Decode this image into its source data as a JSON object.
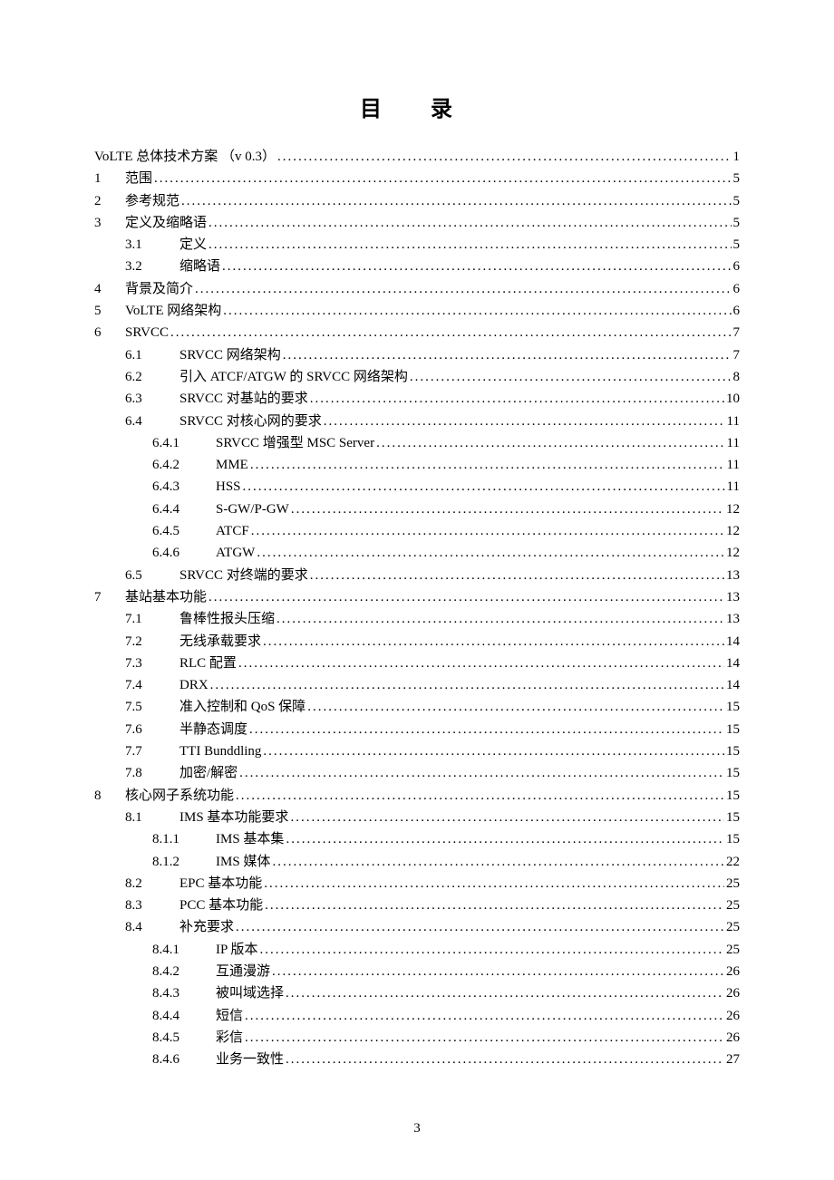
{
  "title": "目 录",
  "page_number": "3",
  "toc": [
    {
      "level": 0,
      "num": "",
      "text": "VoLTE 总体技术方案  （v 0.3）",
      "page": "1"
    },
    {
      "level": 0,
      "num": "1",
      "text": "范围",
      "page": "5"
    },
    {
      "level": 0,
      "num": "2",
      "text": "参考规范",
      "page": "5"
    },
    {
      "level": 0,
      "num": "3",
      "text": "定义及缩略语",
      "page": "5"
    },
    {
      "level": 1,
      "num": "3.1",
      "text": "定义",
      "page": "5"
    },
    {
      "level": 1,
      "num": "3.2",
      "text": "缩略语",
      "page": "6"
    },
    {
      "level": 0,
      "num": "4",
      "text": "背景及简介",
      "page": "6"
    },
    {
      "level": 0,
      "num": "5",
      "text": "VoLTE 网络架构",
      "page": "6"
    },
    {
      "level": 0,
      "num": "6",
      "text": "SRVCC",
      "page": "7"
    },
    {
      "level": 1,
      "num": "6.1",
      "text": "SRVCC 网络架构",
      "page": "7"
    },
    {
      "level": 1,
      "num": "6.2",
      "text": "引入 ATCF/ATGW 的 SRVCC 网络架构",
      "page": "8"
    },
    {
      "level": 1,
      "num": "6.3",
      "text": "SRVCC 对基站的要求",
      "page": "10"
    },
    {
      "level": 1,
      "num": "6.4",
      "text": "SRVCC 对核心网的要求",
      "page": "11"
    },
    {
      "level": 2,
      "num": "6.4.1",
      "text": "SRVCC 增强型 MSC Server",
      "page": "11"
    },
    {
      "level": 2,
      "num": "6.4.2",
      "text": "MME",
      "page": "11"
    },
    {
      "level": 2,
      "num": "6.4.3",
      "text": "HSS",
      "page": "11"
    },
    {
      "level": 2,
      "num": "6.4.4",
      "text": "S-GW/P-GW",
      "page": "12"
    },
    {
      "level": 2,
      "num": "6.4.5",
      "text": "ATCF",
      "page": "12"
    },
    {
      "level": 2,
      "num": "6.4.6",
      "text": "ATGW",
      "page": "12"
    },
    {
      "level": 1,
      "num": "6.5",
      "text": "SRVCC 对终端的要求",
      "page": "13"
    },
    {
      "level": 0,
      "num": "7",
      "text": "基站基本功能",
      "page": "13"
    },
    {
      "level": 1,
      "num": "7.1",
      "text": "鲁棒性报头压缩",
      "page": "13"
    },
    {
      "level": 1,
      "num": "7.2",
      "text": "无线承载要求",
      "page": "14"
    },
    {
      "level": 1,
      "num": "7.3",
      "text": "RLC 配置",
      "page": "14"
    },
    {
      "level": 1,
      "num": "7.4",
      "text": "DRX",
      "page": "14"
    },
    {
      "level": 1,
      "num": "7.5",
      "text": "准入控制和 QoS 保障",
      "page": "15"
    },
    {
      "level": 1,
      "num": "7.6",
      "text": "半静态调度",
      "page": "15"
    },
    {
      "level": 1,
      "num": "7.7",
      "text": "TTI Bunddling",
      "page": "15"
    },
    {
      "level": 1,
      "num": "7.8",
      "text": "加密/解密",
      "page": "15"
    },
    {
      "level": 0,
      "num": "8",
      "text": "核心网子系统功能",
      "page": "15"
    },
    {
      "level": 1,
      "num": "8.1",
      "text": "IMS 基本功能要求",
      "page": "15"
    },
    {
      "level": 2,
      "num": "8.1.1",
      "text": "IMS 基本集",
      "page": "15"
    },
    {
      "level": 2,
      "num": "8.1.2",
      "text": "IMS 媒体",
      "page": "22"
    },
    {
      "level": 1,
      "num": "8.2",
      "text": "EPC 基本功能",
      "page": "25"
    },
    {
      "level": 1,
      "num": "8.3",
      "text": "PCC 基本功能",
      "page": "25"
    },
    {
      "level": 1,
      "num": "8.4",
      "text": "补充要求",
      "page": "25"
    },
    {
      "level": 2,
      "num": "8.4.1",
      "text": "IP 版本",
      "page": "25"
    },
    {
      "level": 2,
      "num": "8.4.2",
      "text": "互通漫游",
      "page": "26"
    },
    {
      "level": 2,
      "num": "8.4.3",
      "text": "被叫域选择",
      "page": "26"
    },
    {
      "level": 2,
      "num": "8.4.4",
      "text": "短信",
      "page": "26"
    },
    {
      "level": 2,
      "num": "8.4.5",
      "text": "彩信",
      "page": "26"
    },
    {
      "level": 2,
      "num": "8.4.6",
      "text": "业务一致性",
      "page": "27"
    }
  ]
}
